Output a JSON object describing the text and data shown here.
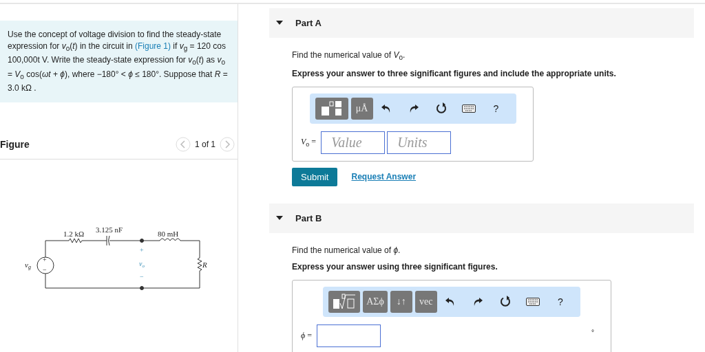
{
  "problem": {
    "text_before": "Use the concept of voltage division to find the steady-state expression for *v*$_{o}$(*t*) in the circuit in",
    "link": "(Figure 1)",
    "text_after": "if *v*$_{g}$ = 120 cos 100,000t V. Write the steady-state expression for *v*$_{o}$(*t*) as *v*$_{o}$ = *V*$_{o}$ cos(*ωt* + *ϕ*), where −180° < *ϕ* ≤ 180°. Suppose that *R* = 3.0  kΩ ."
  },
  "figure": {
    "title": "Figure",
    "pager": "1 of 1",
    "circuit": {
      "resistor": "1.2 kΩ",
      "capacitor": "3.125 nF",
      "inductor": "80 mH",
      "load": "R",
      "source_symbol": "v",
      "source_subscript": "g",
      "source_plus": "+",
      "source_minus": "−",
      "output_symbol": "v",
      "output_subscript": "o",
      "output_plus": "+",
      "output_minus": "−"
    }
  },
  "parts": [
    {
      "title": "Part A",
      "expanded": true,
      "prompt": "Find the numerical value of *V*$_{o}$.",
      "instruction": "Express your answer to three significant figures and include the appropriate units.",
      "toolbar": [
        {
          "kind": "fraction-template"
        },
        {
          "kind": "text",
          "label": "μÅ"
        },
        {
          "kind": "undo"
        },
        {
          "kind": "redo"
        },
        {
          "kind": "reset"
        },
        {
          "kind": "keyboard"
        },
        {
          "kind": "help",
          "label": "?"
        }
      ],
      "field_label": "*V*$_{o}$ =",
      "inputs": [
        {
          "kind": "answer",
          "placeholder": "Value"
        },
        {
          "kind": "answer",
          "placeholder": "Units"
        }
      ],
      "submit": "Submit",
      "request": "Request Answer"
    },
    {
      "title": "Part B",
      "expanded": true,
      "prompt": "Find the numerical value of *ϕ*.",
      "instruction": "Express your answer using three significant figures.",
      "toolbar": [
        {
          "kind": "root-template"
        },
        {
          "kind": "text",
          "label": "ΑΣϕ"
        },
        {
          "kind": "text",
          "label": "↓↑"
        },
        {
          "kind": "text",
          "label": "vec"
        },
        {
          "kind": "undo"
        },
        {
          "kind": "redo"
        },
        {
          "kind": "reset"
        },
        {
          "kind": "keyboard"
        },
        {
          "kind": "help",
          "label": "?"
        }
      ],
      "field_label": "*ϕ* =",
      "inputs": [
        {
          "kind": "answer"
        }
      ],
      "unit": "°"
    }
  ]
}
